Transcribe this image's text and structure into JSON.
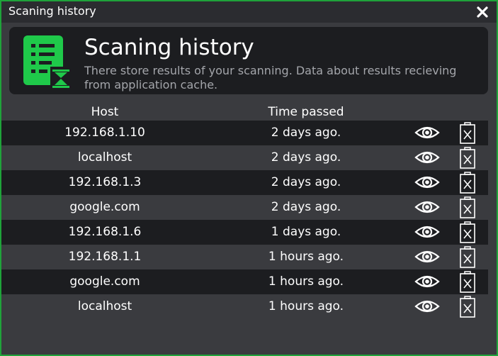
{
  "window": {
    "title": "Scaning history",
    "border_color": "#1fa33a",
    "close_icon": "close-icon"
  },
  "header": {
    "icon": "list-hourglass-icon",
    "icon_color": "#1fc94a",
    "title": "Scaning history",
    "description": "There store results of your scanning. Data about results recieving from application cache."
  },
  "table": {
    "columns": [
      "Host",
      "Time passed"
    ],
    "view_icon": "eye-icon",
    "delete_icon": "trash-icon",
    "rows": [
      {
        "host": "192.168.1.10",
        "time": "2 days ago."
      },
      {
        "host": "localhost",
        "time": "2 days ago."
      },
      {
        "host": "192.168.1.3",
        "time": "2 days ago."
      },
      {
        "host": "google.com",
        "time": "2 days ago."
      },
      {
        "host": "192.168.1.6",
        "time": "1 days ago."
      },
      {
        "host": "192.168.1.1",
        "time": "1 hours ago."
      },
      {
        "host": "google.com",
        "time": "1 hours ago."
      },
      {
        "host": "localhost",
        "time": "1 hours ago."
      }
    ]
  }
}
